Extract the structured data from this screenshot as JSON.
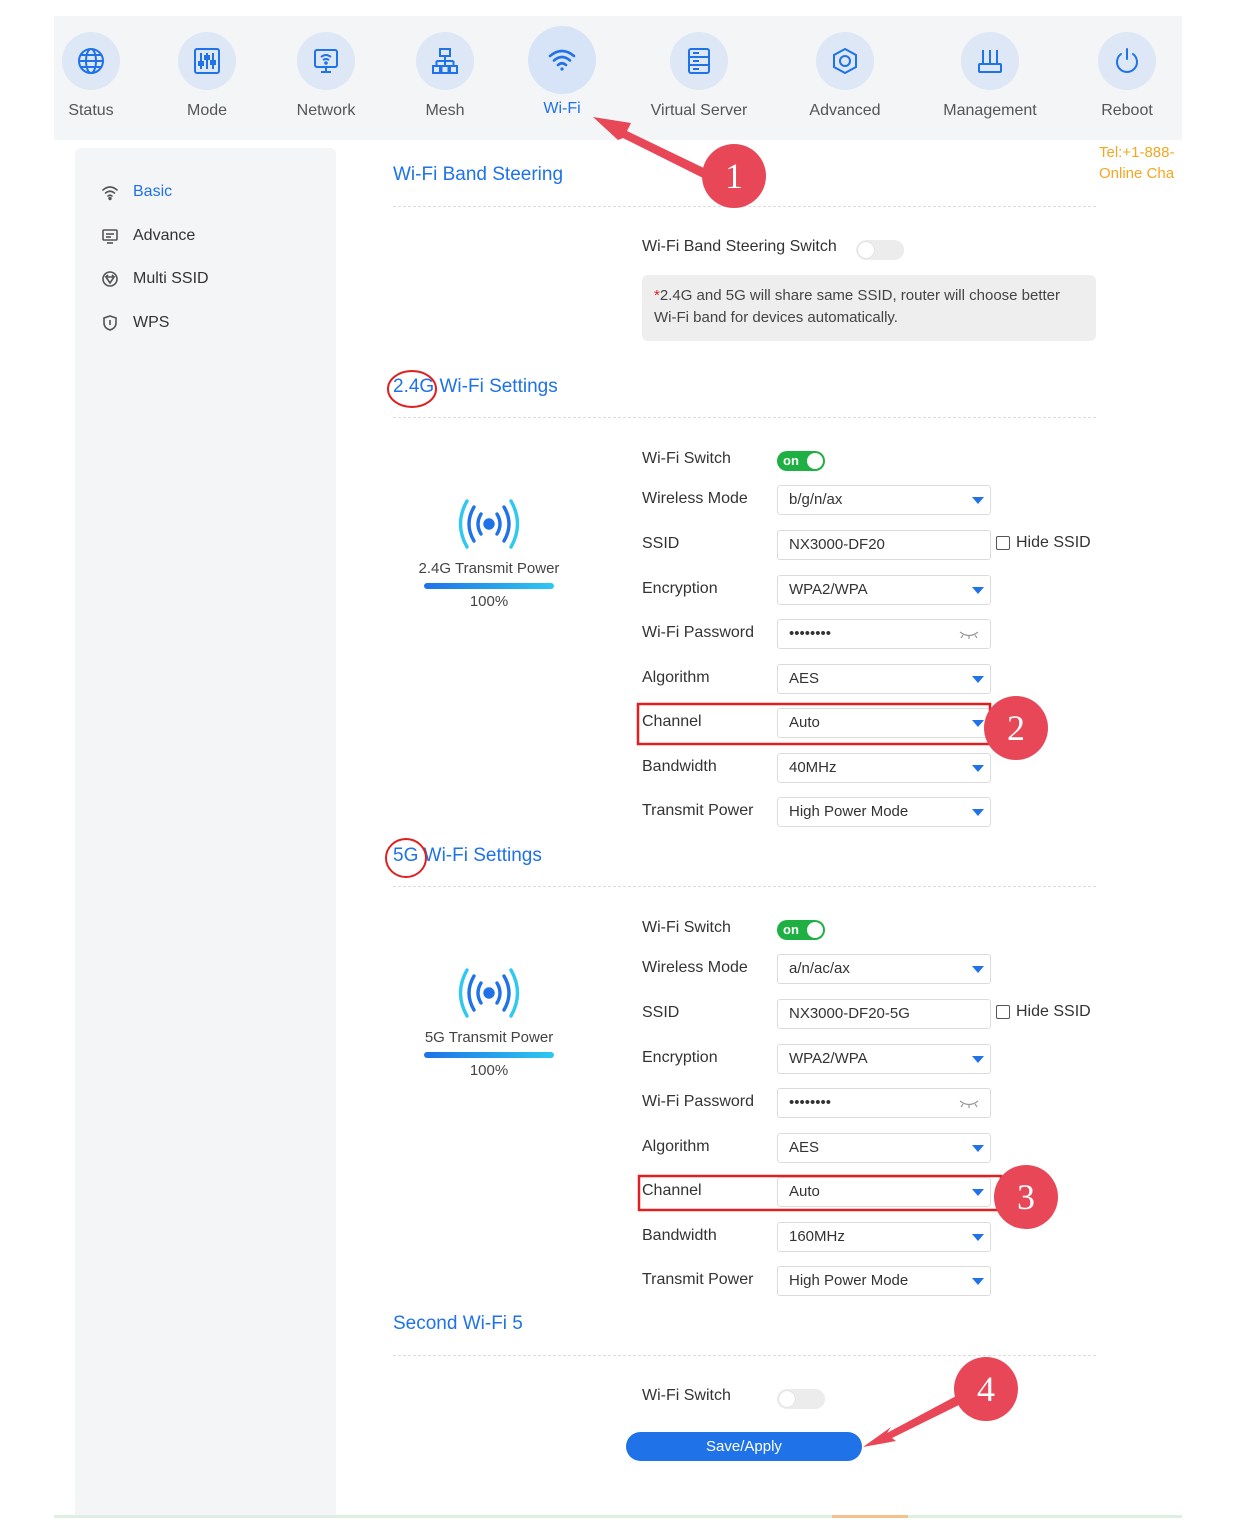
{
  "nav": {
    "items": [
      {
        "label": "Status",
        "icon": "globe-icon"
      },
      {
        "label": "Mode",
        "icon": "sliders-icon"
      },
      {
        "label": "Network",
        "icon": "monitor-icon"
      },
      {
        "label": "Mesh",
        "icon": "mesh-icon"
      },
      {
        "label": "Wi-Fi",
        "icon": "wifi-icon",
        "active": true
      },
      {
        "label": "Virtual Server",
        "icon": "server-icon"
      },
      {
        "label": "Advanced",
        "icon": "hexagon-icon"
      },
      {
        "label": "Management",
        "icon": "router-icon"
      },
      {
        "label": "Reboot",
        "icon": "power-icon"
      }
    ]
  },
  "contact": {
    "tel": "Tel:+1-888-",
    "chat": "Online Cha"
  },
  "sidebar": {
    "items": [
      {
        "label": "Basic",
        "icon": "wifi-small-icon",
        "active": true
      },
      {
        "label": "Advance",
        "icon": "monitor-small-icon"
      },
      {
        "label": "Multi SSID",
        "icon": "gem-icon"
      },
      {
        "label": "WPS",
        "icon": "shield-icon"
      }
    ]
  },
  "band_steering": {
    "title": "Wi-Fi Band Steering",
    "switch_label": "Wi-Fi Band Steering Switch",
    "notice_star": "*",
    "notice": "2.4G and 5G will share same SSID, router will choose better Wi-Fi band for devices automatically."
  },
  "wifi24": {
    "title_band": "2.4G",
    "title_rest": " Wi-Fi Settings",
    "power_title": "2.4G Transmit Power",
    "power_value": "100%",
    "power_fraction": 1.0,
    "switch_label": "Wi-Fi Switch",
    "switch_on": "on",
    "mode_label": "Wireless Mode",
    "mode_value": "b/g/n/ax",
    "ssid_label": "SSID",
    "ssid_value": "NX3000-DF20",
    "hide_ssid": "Hide SSID",
    "enc_label": "Encryption",
    "enc_value": "WPA2/WPA",
    "pwd_label": "Wi-Fi Password",
    "pwd_value": "••••••••",
    "algo_label": "Algorithm",
    "algo_value": "AES",
    "channel_label": "Channel",
    "channel_value": "Auto",
    "bw_label": "Bandwidth",
    "bw_value": "40MHz",
    "tx_label": "Transmit Power",
    "tx_value": "High Power Mode"
  },
  "wifi5": {
    "title_band": "5G",
    "title_rest": " Wi-Fi Settings",
    "power_title": "5G Transmit Power",
    "power_value": "100%",
    "power_fraction": 1.0,
    "switch_label": "Wi-Fi Switch",
    "switch_on": "on",
    "mode_label": "Wireless Mode",
    "mode_value": "a/n/ac/ax",
    "ssid_label": "SSID",
    "ssid_value": "NX3000-DF20-5G",
    "hide_ssid": "Hide SSID",
    "enc_label": "Encryption",
    "enc_value": "WPA2/WPA",
    "pwd_label": "Wi-Fi Password",
    "pwd_value": "••••••••",
    "algo_label": "Algorithm",
    "algo_value": "AES",
    "channel_label": "Channel",
    "channel_value": "Auto",
    "bw_label": "Bandwidth",
    "bw_value": "160MHz",
    "tx_label": "Transmit Power",
    "tx_value": "High Power Mode"
  },
  "second_wifi": {
    "title": "Second Wi-Fi 5",
    "switch_label": "Wi-Fi Switch"
  },
  "apply_label": "Save/Apply",
  "annotations": {
    "step1": "1",
    "step2": "2",
    "step3": "3",
    "step4": "4",
    "color": "#e74756"
  },
  "colors": {
    "accent": "#1f72e8",
    "on": "#1fb043",
    "contact": "#f5a623"
  }
}
